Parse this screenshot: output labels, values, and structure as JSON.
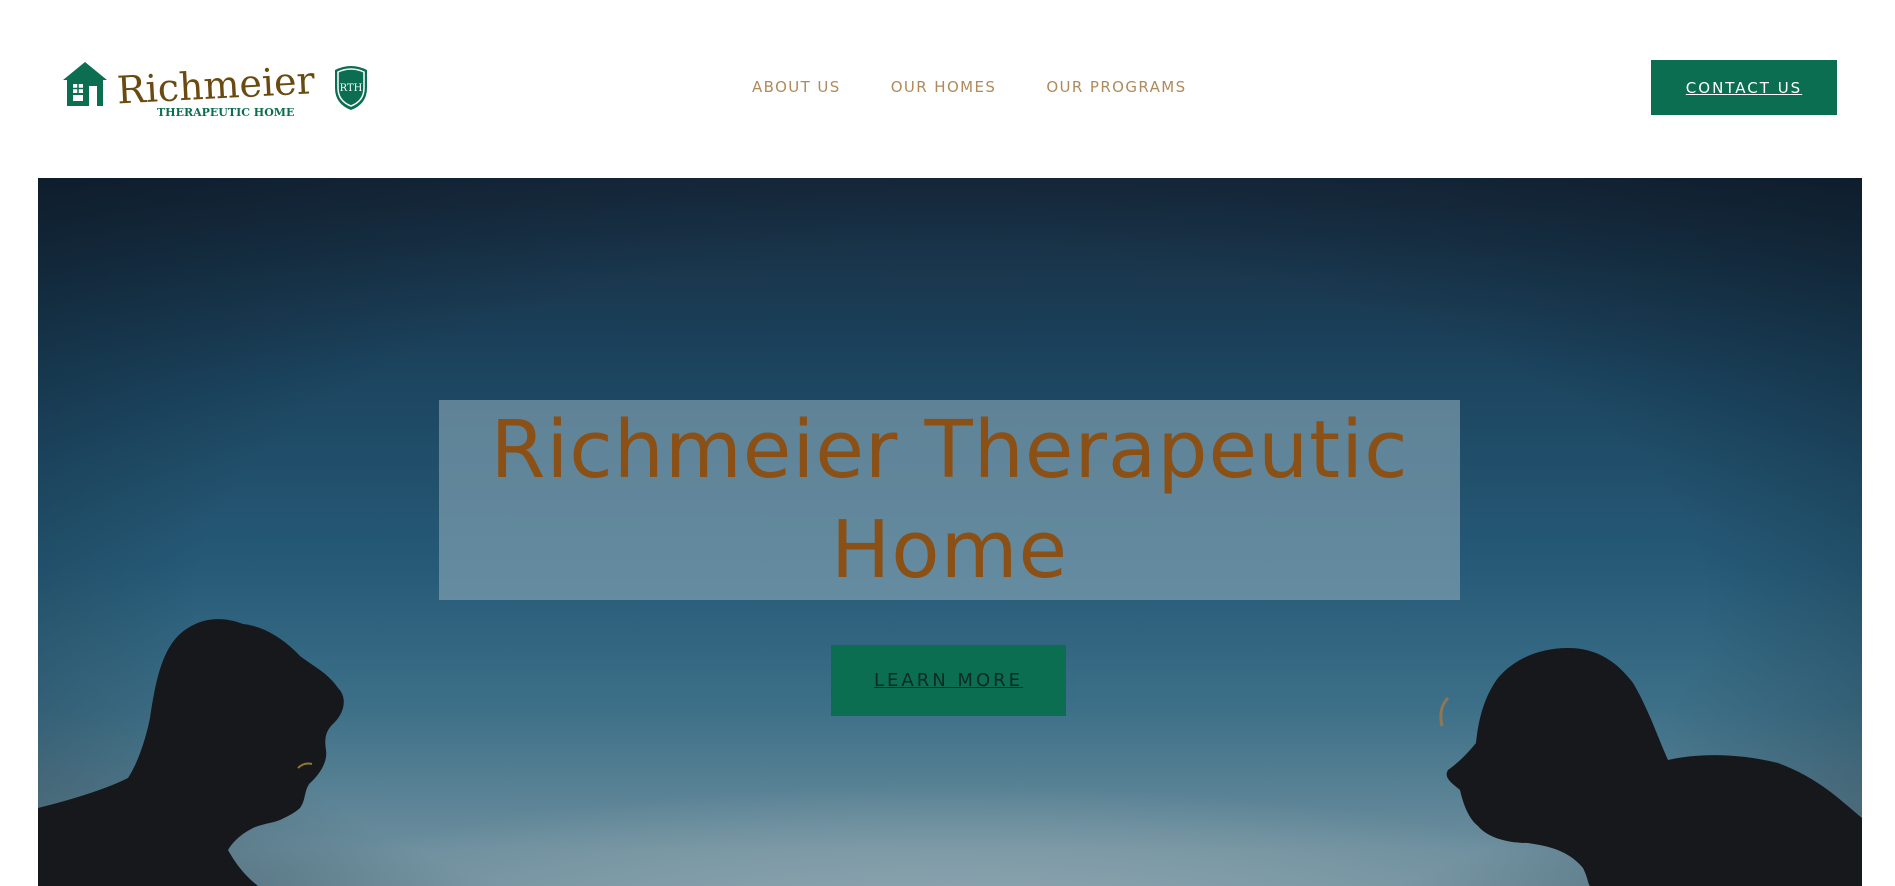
{
  "brand": {
    "name": "Richmeier",
    "tagline": "THERAPEUTIC HOME",
    "monogram": "RTH",
    "colors": {
      "green": "#0b6e50",
      "brown": "#6b4a10"
    }
  },
  "nav": {
    "items": [
      {
        "label": "ABOUT US"
      },
      {
        "label": "OUR HOMES"
      },
      {
        "label": "OUR PROGRAMS"
      }
    ],
    "contact_label": "CONTACT US"
  },
  "hero": {
    "title": "Richmeier Therapeutic Home",
    "cta_label": "LEARN MORE"
  },
  "colors": {
    "accent_green": "#0b6e50",
    "nav_text": "#b08a5a",
    "title_text": "#8a5016"
  }
}
